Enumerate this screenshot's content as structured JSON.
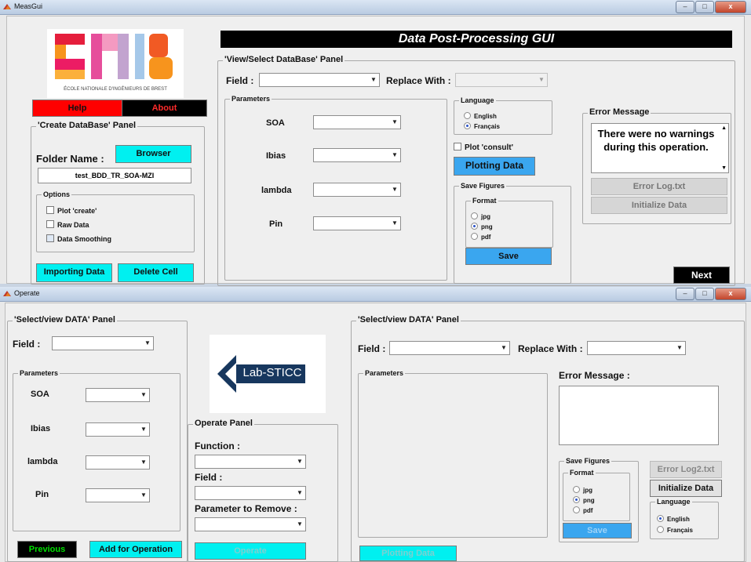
{
  "colors": {
    "cyan": "#00f0f0",
    "red": "#ff0000",
    "black": "#000000",
    "blue": "#3aa6ef"
  },
  "meas": {
    "title": "MeasGui",
    "logo_alt": "ENIB",
    "logo_sub": "ÉCOLE NATIONALE D'INGÉNIEURS DE BREST",
    "banner": "Data Post-Processing GUI",
    "help": "Help",
    "about": "About",
    "create_panel": "'Create DataBase' Panel",
    "folder_name": "Folder Name :",
    "browser": "Browser",
    "folder_value": "test_BDD_TR_SOA-MZI",
    "options": "Options",
    "opt_plot": "Plot 'create'",
    "opt_raw": "Raw Data",
    "opt_smooth": "Data Smoothing",
    "importing": "Importing Data",
    "delete_cell": "Delete Cell",
    "view_panel": "'View/Select DataBase' Panel",
    "field": "Field :",
    "replace_with": "Replace With :",
    "parameters": "Parameters",
    "params": [
      "SOA",
      "Ibias",
      "lambda",
      "Pin"
    ],
    "language": "Language",
    "lang_en": "English",
    "lang_fr": "Français",
    "plot_consult": "Plot 'consult'",
    "plotting": "Plotting Data",
    "save_figures": "Save Figures",
    "format": "Format",
    "fmt": [
      "jpg",
      "png",
      "pdf"
    ],
    "save": "Save",
    "error_message": "Error Message",
    "error_text": "There were no warnings during this operation.",
    "error_log": "Error Log.txt",
    "initialize": "Initialize Data",
    "next": "Next"
  },
  "operate": {
    "title": "Operate",
    "select_panel": "'Select/view DATA' Panel",
    "field": "Field :",
    "parameters": "Parameters",
    "params": [
      "SOA",
      "Ibias",
      "lambda",
      "Pin"
    ],
    "previous": "Previous",
    "add_op": "Add for Operation",
    "logo": "Lab-STICC",
    "operate_panel": "Operate Panel",
    "function": "Function :",
    "field2": "Field :",
    "param_remove": "Parameter to Remove :",
    "operate_btn": "Operate",
    "select_panel2": "'Select/view DATA' Panel",
    "replace_with": "Replace With :",
    "error_message": "Error Message :",
    "save_figures": "Save Figures",
    "format": "Format",
    "fmt": [
      "jpg",
      "png",
      "pdf"
    ],
    "save": "Save",
    "error_log2": "Error Log2.txt",
    "initialize": "Initialize Data",
    "language": "Language",
    "lang_en": "English",
    "lang_fr": "Français",
    "plotting": "Plotting Data"
  }
}
